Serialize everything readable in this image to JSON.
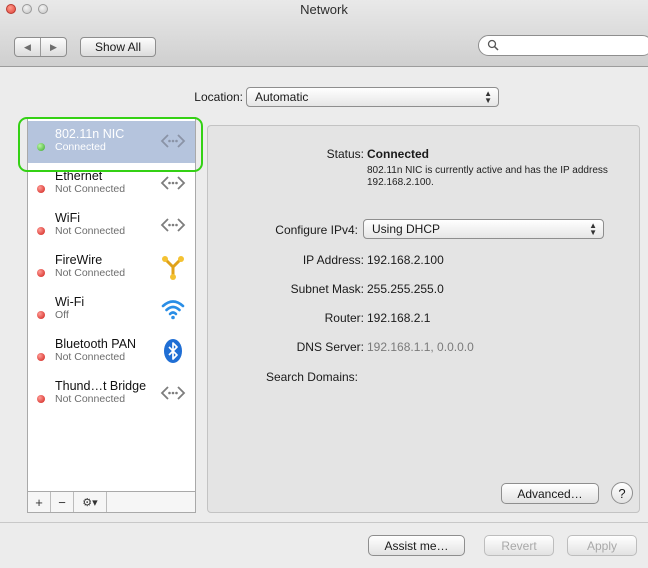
{
  "window": {
    "title": "Network"
  },
  "toolbar": {
    "back_label": "◀",
    "forward_label": "▶",
    "show_all_label": "Show All",
    "search_placeholder": ""
  },
  "location": {
    "label": "Location:",
    "value": "Automatic"
  },
  "sidebar": {
    "items": [
      {
        "name": "802.11n NIC",
        "status": "Connected",
        "state": "connected",
        "icon": "network-arrows-icon"
      },
      {
        "name": "Ethernet",
        "status": "Not Connected",
        "state": "disconnected",
        "icon": "network-arrows-icon"
      },
      {
        "name": "WiFi",
        "status": "Not Connected",
        "state": "disconnected",
        "icon": "network-arrows-icon"
      },
      {
        "name": "FireWire",
        "status": "Not Connected",
        "state": "disconnected",
        "icon": "firewire-icon"
      },
      {
        "name": "Wi-Fi",
        "status": "Off",
        "state": "off",
        "icon": "wifi-icon"
      },
      {
        "name": "Bluetooth PAN",
        "status": "Not Connected",
        "state": "disconnected",
        "icon": "bluetooth-icon"
      },
      {
        "name": "Thund…t Bridge",
        "status": "Not Connected",
        "state": "disconnected",
        "icon": "network-arrows-icon"
      }
    ],
    "add_label": "+",
    "remove_label": "−",
    "gear_label": "⚙▾"
  },
  "detail": {
    "status_label": "Status:",
    "status_value": "Connected",
    "status_description": "802.11n NIC is currently active and has the IP address 192.168.2.100.",
    "configure_label": "Configure IPv4:",
    "configure_value": "Using DHCP",
    "ip_label": "IP Address:",
    "ip_value": "192.168.2.100",
    "subnet_label": "Subnet Mask:",
    "subnet_value": "255.255.255.0",
    "router_label": "Router:",
    "router_value": "192.168.2.1",
    "dns_label": "DNS Server:",
    "dns_value": "192.168.1.1, 0.0.0.0",
    "search_domains_label": "Search Domains:",
    "advanced_label": "Advanced…",
    "help_label": "?"
  },
  "footer": {
    "assist_label": "Assist me…",
    "revert_label": "Revert",
    "apply_label": "Apply"
  },
  "colors": {
    "selection": "#b5c4dd",
    "connected": "#38a82a",
    "disconnected": "#cf1d17",
    "highlight_ring": "#34d114"
  }
}
